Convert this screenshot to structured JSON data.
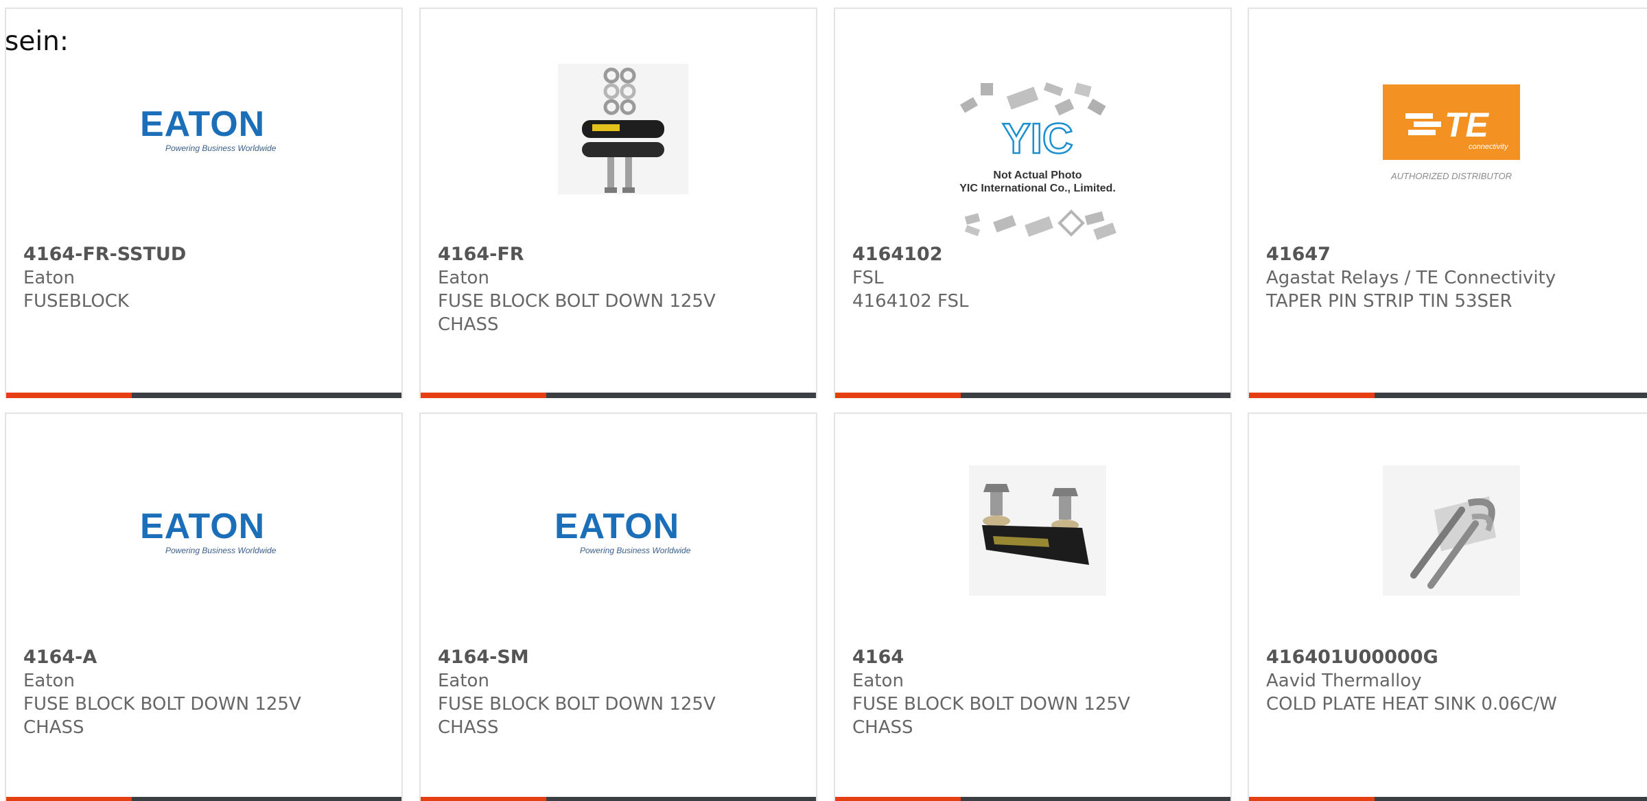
{
  "intro_text": "sein:",
  "accent_color": "#e43e12",
  "bar_color": "#3b3e42",
  "cards": [
    {
      "part": "4164-FR-SSTUD",
      "manufacturer": "Eaton",
      "description": "FUSEBLOCK",
      "image": "eaton-logo",
      "logo_text": "EATON",
      "logo_tagline": "Powering Business Worldwide"
    },
    {
      "part": "4164-FR",
      "manufacturer": "Eaton",
      "description": "FUSE BLOCK BOLT DOWN 125V CHASS",
      "image": "fuse-block-kit-photo"
    },
    {
      "part": "4164102",
      "manufacturer": "FSL",
      "description": "4164102 FSL",
      "image": "yic-placeholder",
      "logo_text": "YIC",
      "placeholder_line1": "Not Actual Photo",
      "placeholder_line2": "YIC International Co., Limited."
    },
    {
      "part": "41647",
      "manufacturer": "Agastat Relays / TE Connectivity",
      "description": "TAPER PIN STRIP TIN 53SER",
      "image": "te-logo",
      "logo_text": "TE",
      "logo_sub": "connectivity",
      "logo_caption": "AUTHORIZED DISTRIBUTOR"
    },
    {
      "part": "4164-A",
      "manufacturer": "Eaton",
      "description": "FUSE BLOCK BOLT DOWN 125V CHASS",
      "image": "eaton-logo",
      "logo_text": "EATON",
      "logo_tagline": "Powering Business Worldwide"
    },
    {
      "part": "4164-SM",
      "manufacturer": "Eaton",
      "description": "FUSE BLOCK BOLT DOWN 125V CHASS",
      "image": "eaton-logo",
      "logo_text": "EATON",
      "logo_tagline": "Powering Business Worldwide"
    },
    {
      "part": "4164",
      "manufacturer": "Eaton",
      "description": "FUSE BLOCK BOLT DOWN 125V CHASS",
      "image": "fuse-block-photo"
    },
    {
      "part": "416401U00000G",
      "manufacturer": "Aavid Thermalloy",
      "description": "COLD PLATE HEAT SINK 0.06C/W",
      "image": "cold-plate-photo"
    }
  ]
}
